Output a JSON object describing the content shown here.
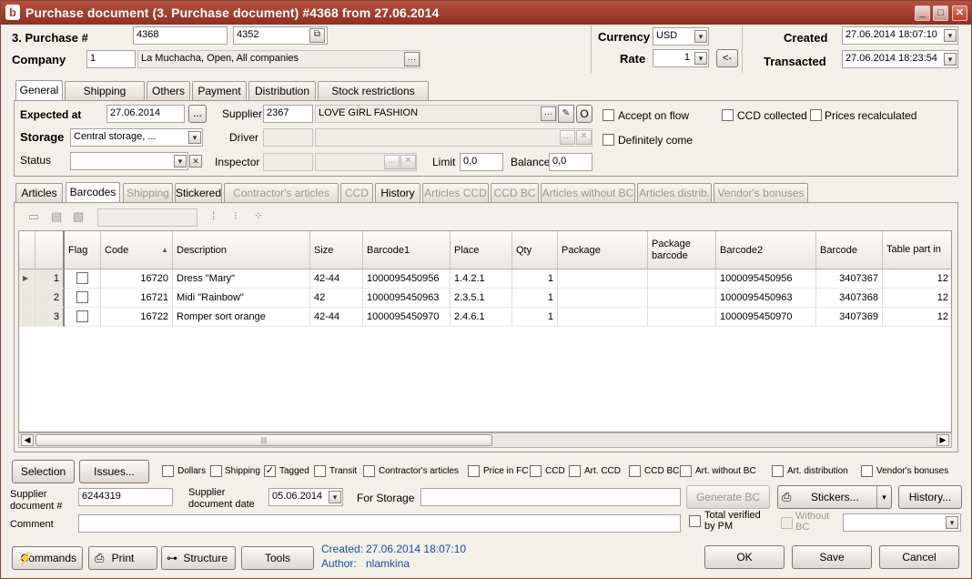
{
  "window": {
    "title": "Purchase document (3. Purchase document) #4368 from 27.06.2014",
    "controls": [
      "minimize",
      "maximize",
      "close"
    ]
  },
  "header": {
    "purchase_label": "3. Purchase #",
    "purchase_no": "4368",
    "purchase_no2": "4352",
    "company_label": "Company",
    "company_id": "1",
    "company_name": "La Muchacha, Open, All companies",
    "currency_label": "Currency",
    "currency": "USD",
    "rate_label": "Rate",
    "rate": "1",
    "rate_button": "<-",
    "created_label": "Created",
    "created": "27.06.2014 18:07:10",
    "transacted_label": "Transacted",
    "transacted": "27.06.2014 18:23:54"
  },
  "top_tabs": [
    "General",
    "Shipping",
    "Others",
    "Payment",
    "Distribution",
    "Stock restrictions"
  ],
  "general": {
    "expected_label": "Expected at",
    "expected": "27.06.2014",
    "ellipsis": "...",
    "storage_label": "Storage",
    "storage": "Central storage, ...",
    "status_label": "Status",
    "status": "",
    "supplier_label": "Supplier",
    "supplier_id": "2367",
    "supplier_name": "LOVE GIRL FASHION",
    "supplier_o": "O",
    "driver_label": "Driver",
    "inspector_label": "Inspector",
    "limit_label": "Limit",
    "limit": "0,0",
    "balance_label": "Balance",
    "balance": "0,0",
    "accept_on_flow": "Accept on flow",
    "definitely_come": "Definitely come",
    "ccd_collected": "CCD collected",
    "prices_recalculated": "Prices recalculated"
  },
  "sub_tabs": [
    "Articles",
    "Barcodes",
    "Shipping",
    "Stickered",
    "Contractor's articles",
    "CCD",
    "History",
    "Articles CCD",
    "CCD BC",
    "Articles without BC",
    "Articles distrib.",
    "Vendor's bonuses"
  ],
  "grid": {
    "columns": [
      "Flag",
      "Code",
      "Description",
      "Size",
      "Barcode1",
      "Place",
      "Qty",
      "Package",
      "Package barcode",
      "Barcode2",
      "Barcode",
      "Table part in"
    ],
    "rows": [
      {
        "num": "1",
        "code": "16720",
        "description": "Dress \"Mary\"",
        "size": "42-44",
        "barcode1": "1000095450956",
        "place": "1.4.2.1",
        "qty": "1",
        "package": "",
        "package_barcode": "",
        "barcode2": "1000095450956",
        "barcode": "3407367",
        "table_part": "12"
      },
      {
        "num": "2",
        "code": "16721",
        "description": "Midi \"Rainbow\"",
        "size": "42",
        "barcode1": "1000095450963",
        "place": "2.3.5.1",
        "qty": "1",
        "package": "",
        "package_barcode": "",
        "barcode2": "1000095450963",
        "barcode": "3407368",
        "table_part": "12"
      },
      {
        "num": "3",
        "code": "16722",
        "description": "Romper sort orange",
        "size": "42-44",
        "barcode1": "1000095450970",
        "place": "2.4.6.1",
        "qty": "1",
        "package": "",
        "package_barcode": "",
        "barcode2": "1000095450970",
        "barcode": "3407369",
        "table_part": "12"
      }
    ]
  },
  "filters": {
    "selection": "Selection",
    "issues": "Issues...",
    "items": [
      {
        "label": "Dollars",
        "checked": false
      },
      {
        "label": "Shipping",
        "checked": false
      },
      {
        "label": "Tagged",
        "checked": true
      },
      {
        "label": "Transit",
        "checked": false
      },
      {
        "label": "Contractor's articles",
        "checked": false
      },
      {
        "label": "Price in FC",
        "checked": false
      },
      {
        "label": "CCD",
        "checked": false
      },
      {
        "label": "Art. CCD",
        "checked": false
      },
      {
        "label": "CCD BC",
        "checked": false
      },
      {
        "label": "Art. without BC",
        "checked": false
      },
      {
        "label": "Art. distribution",
        "checked": false
      },
      {
        "label": "Vendor's bonuses",
        "checked": false
      }
    ]
  },
  "footer_fields": {
    "supplier_doc_label": "Supplier document #",
    "supplier_doc": "6244319",
    "supplier_doc_date_label": "Supplier document date",
    "supplier_doc_date": "05.06.2014",
    "for_storage_label": "For Storage",
    "generate_bc": "Generate BC",
    "stickers": "Stickers...",
    "history": "History...",
    "comment_label": "Comment",
    "total_verified": "Total verified by PM",
    "without_bc": "Without BC"
  },
  "bottom": {
    "commands": "Commands",
    "print": "Print",
    "structure": "Structure",
    "tools": "Tools",
    "created_label": "Created:",
    "created_value": "27.06.2014 18:07:10",
    "author_label": "Author:",
    "author_value": "nlamkina",
    "ok": "OK",
    "save": "Save",
    "cancel": "Cancel"
  }
}
